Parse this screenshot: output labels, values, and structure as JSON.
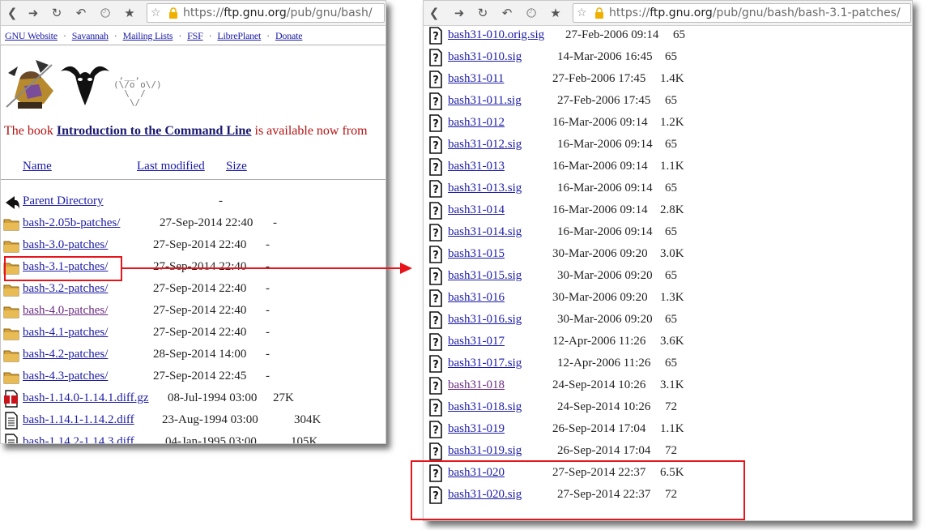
{
  "left_browser": {
    "url_scheme": "https://",
    "url_host": "ftp.gnu.org",
    "url_path": "/pub/gnu/bash/",
    "nav_links": [
      "GNU Website",
      "Savannah",
      "Mailing Lists",
      "FSF",
      "LibrePlanet",
      "Donate"
    ],
    "book_prefix": "The book ",
    "book_link": "Introduction to the Command Line",
    "book_suffix": " is available now from",
    "columns": {
      "name": "Name",
      "modified": "Last modified",
      "size": "Size"
    },
    "parent": {
      "name": "Parent Directory",
      "size": "-"
    },
    "rows": [
      {
        "name": "bash-2.05b-patches/",
        "date": "27-Sep-2014 22:40",
        "size": "-",
        "icon": "folder-icon"
      },
      {
        "name": "bash-3.0-patches/",
        "date": "27-Sep-2014 22:40",
        "size": "-",
        "icon": "folder-icon"
      },
      {
        "name": "bash-3.1-patches/",
        "date": "27-Sep-2014 22:40",
        "size": "-",
        "icon": "folder-icon"
      },
      {
        "name": "bash-3.2-patches/",
        "date": "27-Sep-2014 22:40",
        "size": "-",
        "icon": "folder-icon"
      },
      {
        "name": "bash-4.0-patches/",
        "date": "27-Sep-2014 22:40",
        "size": "-",
        "icon": "folder-icon"
      },
      {
        "name": "bash-4.1-patches/",
        "date": "27-Sep-2014 22:40",
        "size": "-",
        "icon": "folder-icon"
      },
      {
        "name": "bash-4.2-patches/",
        "date": "28-Sep-2014 14:00",
        "size": "-",
        "icon": "folder-icon"
      },
      {
        "name": "bash-4.3-patches/",
        "date": "27-Sep-2014 22:45",
        "size": "-",
        "icon": "folder-icon"
      },
      {
        "name": "bash-1.14.0-1.14.1.diff.gz",
        "date": "08-Jul-1994 03:00",
        "size": "27K",
        "icon": "compressed-file-icon"
      },
      {
        "name": "bash-1.14.1-1.14.2.diff",
        "date": "23-Aug-1994 03:00",
        "size": "304K",
        "icon": "text-file-icon"
      },
      {
        "name": "bash-1.14.2-1.14.3.diff",
        "date": "04-Jan-1995 03:00",
        "size": "105K",
        "icon": "text-file-icon"
      }
    ]
  },
  "right_browser": {
    "url_scheme": "https://",
    "url_host": "ftp.gnu.org",
    "url_path": "/pub/gnu/bash/bash-3.1-patches/",
    "rows": [
      {
        "name": "bash31-010.orig.sig",
        "date": "27-Feb-2006 09:14",
        "size": "65"
      },
      {
        "name": "bash31-010.sig",
        "date": "14-Mar-2006 16:45",
        "size": "65"
      },
      {
        "name": "bash31-011",
        "date": "27-Feb-2006 17:45",
        "size": "1.4K"
      },
      {
        "name": "bash31-011.sig",
        "date": "27-Feb-2006 17:45",
        "size": "65"
      },
      {
        "name": "bash31-012",
        "date": "16-Mar-2006 09:14",
        "size": "1.2K"
      },
      {
        "name": "bash31-012.sig",
        "date": "16-Mar-2006 09:14",
        "size": "65"
      },
      {
        "name": "bash31-013",
        "date": "16-Mar-2006 09:14",
        "size": "1.1K"
      },
      {
        "name": "bash31-013.sig",
        "date": "16-Mar-2006 09:14",
        "size": "65"
      },
      {
        "name": "bash31-014",
        "date": "16-Mar-2006 09:14",
        "size": "2.8K"
      },
      {
        "name": "bash31-014.sig",
        "date": "16-Mar-2006 09:14",
        "size": "65"
      },
      {
        "name": "bash31-015",
        "date": "30-Mar-2006 09:20",
        "size": "3.0K"
      },
      {
        "name": "bash31-015.sig",
        "date": "30-Mar-2006 09:20",
        "size": "65"
      },
      {
        "name": "bash31-016",
        "date": "30-Mar-2006 09:20",
        "size": "1.3K"
      },
      {
        "name": "bash31-016.sig",
        "date": "30-Mar-2006 09:20",
        "size": "65"
      },
      {
        "name": "bash31-017",
        "date": "12-Apr-2006 11:26",
        "size": "3.6K"
      },
      {
        "name": "bash31-017.sig",
        "date": "12-Apr-2006 11:26",
        "size": "65"
      },
      {
        "name": "bash31-018",
        "date": "24-Sep-2014 10:26",
        "size": "3.1K",
        "visited": true
      },
      {
        "name": "bash31-018.sig",
        "date": "24-Sep-2014 10:26",
        "size": "72"
      },
      {
        "name": "bash31-019",
        "date": "26-Sep-2014 17:04",
        "size": "1.1K"
      },
      {
        "name": "bash31-019.sig",
        "date": "26-Sep-2014 17:04",
        "size": "72"
      },
      {
        "name": "bash31-020",
        "date": "27-Sep-2014 22:37",
        "size": "6.5K"
      },
      {
        "name": "bash31-020.sig",
        "date": "27-Sep-2014 22:37",
        "size": "72"
      }
    ]
  },
  "colors": {
    "annotation": "#e8141b",
    "link": "#1a1aa6",
    "visited_link": "#6a2a82",
    "book_text": "#b31212"
  }
}
